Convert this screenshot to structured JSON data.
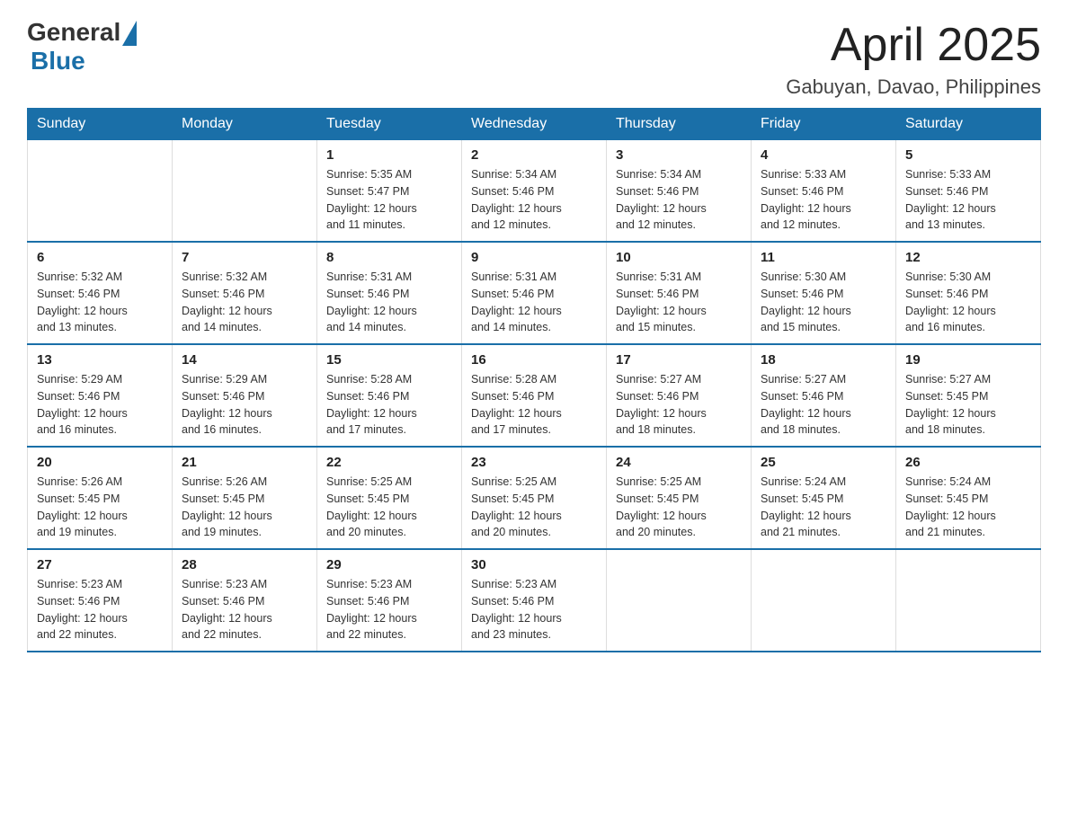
{
  "logo": {
    "general": "General",
    "blue": "Blue"
  },
  "title": "April 2025",
  "subtitle": "Gabuyan, Davao, Philippines",
  "weekdays": [
    "Sunday",
    "Monday",
    "Tuesday",
    "Wednesday",
    "Thursday",
    "Friday",
    "Saturday"
  ],
  "weeks": [
    [
      {
        "day": "",
        "info": ""
      },
      {
        "day": "",
        "info": ""
      },
      {
        "day": "1",
        "info": "Sunrise: 5:35 AM\nSunset: 5:47 PM\nDaylight: 12 hours\nand 11 minutes."
      },
      {
        "day": "2",
        "info": "Sunrise: 5:34 AM\nSunset: 5:46 PM\nDaylight: 12 hours\nand 12 minutes."
      },
      {
        "day": "3",
        "info": "Sunrise: 5:34 AM\nSunset: 5:46 PM\nDaylight: 12 hours\nand 12 minutes."
      },
      {
        "day": "4",
        "info": "Sunrise: 5:33 AM\nSunset: 5:46 PM\nDaylight: 12 hours\nand 12 minutes."
      },
      {
        "day": "5",
        "info": "Sunrise: 5:33 AM\nSunset: 5:46 PM\nDaylight: 12 hours\nand 13 minutes."
      }
    ],
    [
      {
        "day": "6",
        "info": "Sunrise: 5:32 AM\nSunset: 5:46 PM\nDaylight: 12 hours\nand 13 minutes."
      },
      {
        "day": "7",
        "info": "Sunrise: 5:32 AM\nSunset: 5:46 PM\nDaylight: 12 hours\nand 14 minutes."
      },
      {
        "day": "8",
        "info": "Sunrise: 5:31 AM\nSunset: 5:46 PM\nDaylight: 12 hours\nand 14 minutes."
      },
      {
        "day": "9",
        "info": "Sunrise: 5:31 AM\nSunset: 5:46 PM\nDaylight: 12 hours\nand 14 minutes."
      },
      {
        "day": "10",
        "info": "Sunrise: 5:31 AM\nSunset: 5:46 PM\nDaylight: 12 hours\nand 15 minutes."
      },
      {
        "day": "11",
        "info": "Sunrise: 5:30 AM\nSunset: 5:46 PM\nDaylight: 12 hours\nand 15 minutes."
      },
      {
        "day": "12",
        "info": "Sunrise: 5:30 AM\nSunset: 5:46 PM\nDaylight: 12 hours\nand 16 minutes."
      }
    ],
    [
      {
        "day": "13",
        "info": "Sunrise: 5:29 AM\nSunset: 5:46 PM\nDaylight: 12 hours\nand 16 minutes."
      },
      {
        "day": "14",
        "info": "Sunrise: 5:29 AM\nSunset: 5:46 PM\nDaylight: 12 hours\nand 16 minutes."
      },
      {
        "day": "15",
        "info": "Sunrise: 5:28 AM\nSunset: 5:46 PM\nDaylight: 12 hours\nand 17 minutes."
      },
      {
        "day": "16",
        "info": "Sunrise: 5:28 AM\nSunset: 5:46 PM\nDaylight: 12 hours\nand 17 minutes."
      },
      {
        "day": "17",
        "info": "Sunrise: 5:27 AM\nSunset: 5:46 PM\nDaylight: 12 hours\nand 18 minutes."
      },
      {
        "day": "18",
        "info": "Sunrise: 5:27 AM\nSunset: 5:46 PM\nDaylight: 12 hours\nand 18 minutes."
      },
      {
        "day": "19",
        "info": "Sunrise: 5:27 AM\nSunset: 5:45 PM\nDaylight: 12 hours\nand 18 minutes."
      }
    ],
    [
      {
        "day": "20",
        "info": "Sunrise: 5:26 AM\nSunset: 5:45 PM\nDaylight: 12 hours\nand 19 minutes."
      },
      {
        "day": "21",
        "info": "Sunrise: 5:26 AM\nSunset: 5:45 PM\nDaylight: 12 hours\nand 19 minutes."
      },
      {
        "day": "22",
        "info": "Sunrise: 5:25 AM\nSunset: 5:45 PM\nDaylight: 12 hours\nand 20 minutes."
      },
      {
        "day": "23",
        "info": "Sunrise: 5:25 AM\nSunset: 5:45 PM\nDaylight: 12 hours\nand 20 minutes."
      },
      {
        "day": "24",
        "info": "Sunrise: 5:25 AM\nSunset: 5:45 PM\nDaylight: 12 hours\nand 20 minutes."
      },
      {
        "day": "25",
        "info": "Sunrise: 5:24 AM\nSunset: 5:45 PM\nDaylight: 12 hours\nand 21 minutes."
      },
      {
        "day": "26",
        "info": "Sunrise: 5:24 AM\nSunset: 5:45 PM\nDaylight: 12 hours\nand 21 minutes."
      }
    ],
    [
      {
        "day": "27",
        "info": "Sunrise: 5:23 AM\nSunset: 5:46 PM\nDaylight: 12 hours\nand 22 minutes."
      },
      {
        "day": "28",
        "info": "Sunrise: 5:23 AM\nSunset: 5:46 PM\nDaylight: 12 hours\nand 22 minutes."
      },
      {
        "day": "29",
        "info": "Sunrise: 5:23 AM\nSunset: 5:46 PM\nDaylight: 12 hours\nand 22 minutes."
      },
      {
        "day": "30",
        "info": "Sunrise: 5:23 AM\nSunset: 5:46 PM\nDaylight: 12 hours\nand 23 minutes."
      },
      {
        "day": "",
        "info": ""
      },
      {
        "day": "",
        "info": ""
      },
      {
        "day": "",
        "info": ""
      }
    ]
  ]
}
